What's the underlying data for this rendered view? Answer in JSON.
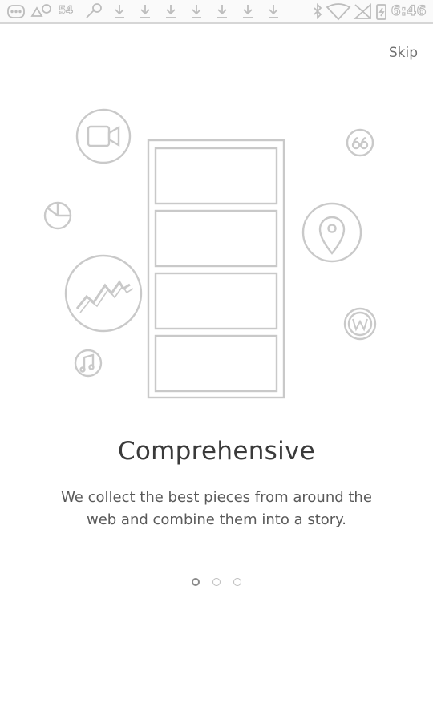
{
  "status_bar": {
    "notification_count": "54",
    "time": "6:46"
  },
  "header": {
    "skip_label": "Skip"
  },
  "onboarding": {
    "title": "Comprehensive",
    "description": "We collect the best pieces from around the web and combine them into a story.",
    "icons": [
      "video-camera-icon",
      "pie-chart-icon",
      "activity-graph-icon",
      "music-note-icon",
      "quote-icon",
      "location-pin-icon",
      "wordpress-icon"
    ],
    "pager": {
      "pages": 3,
      "current": 1
    }
  },
  "colors": {
    "line_art": "#c4c4c4",
    "title_text": "#3a3a3a",
    "body_text": "#5a5a5a",
    "background": "#ffffff"
  }
}
